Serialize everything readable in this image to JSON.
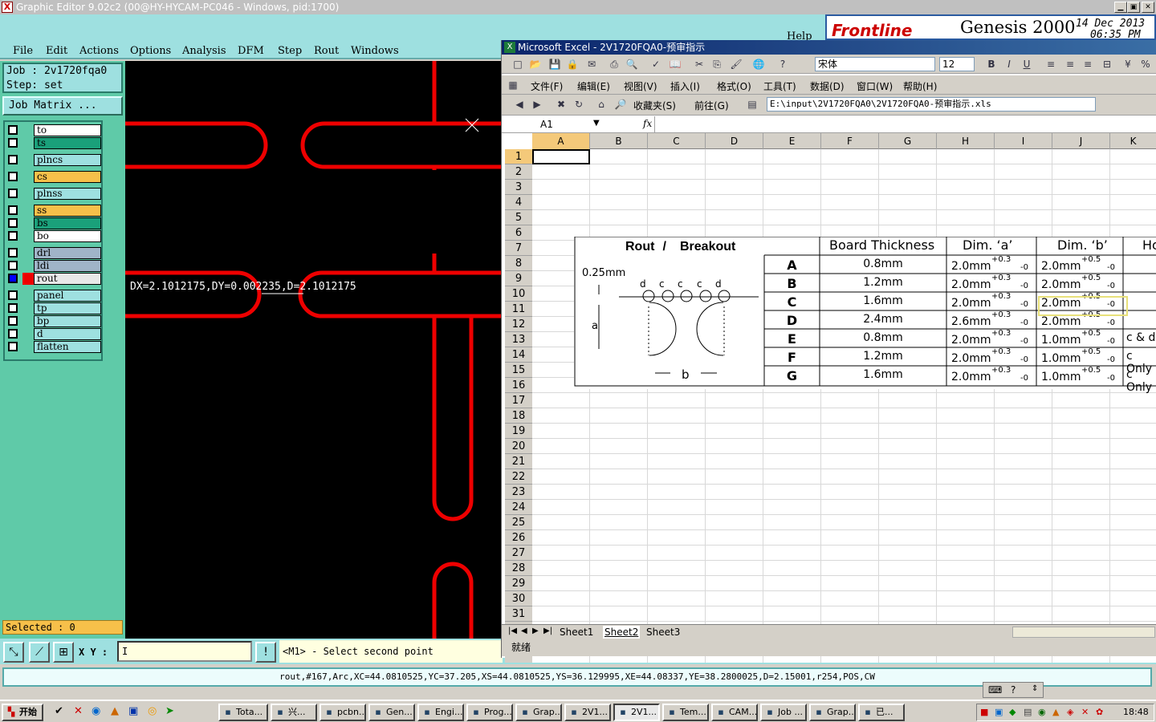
{
  "window": {
    "title": "Graphic Editor 9.02c2 (00@HY-HYCAM-PC046 - Windows, pid:1700)"
  },
  "menu": [
    "File",
    "Edit",
    "Actions",
    "Options",
    "Analysis",
    "DFM",
    "Step",
    "Rout",
    "Windows"
  ],
  "menu_help": "Help",
  "logo": {
    "brand": "Frontline",
    "product": "Genesis 2000",
    "date": "14 Dec 2013",
    "time": "06:35 PM"
  },
  "job": {
    "job_line": "Job  : 2v1720fqa0",
    "step_line": "Step: set",
    "matrix_button": "Job Matrix ..."
  },
  "layers": [
    {
      "name": "to",
      "color": "#ffffff"
    },
    {
      "name": "ts",
      "color": "#1aa07a"
    },
    {
      "name": "plncs",
      "color": "#9ee0e0"
    },
    {
      "name": "cs",
      "color": "#f6c04a"
    },
    {
      "name": "plnss",
      "color": "#9ee0e0"
    },
    {
      "name": "ss",
      "color": "#f6c04a"
    },
    {
      "name": "bs",
      "color": "#1aa07a"
    },
    {
      "name": "bo",
      "color": "#ffffff"
    },
    {
      "name": "drl",
      "color": "#a0b4c8"
    },
    {
      "name": "ldi",
      "color": "#a0b4c8"
    },
    {
      "name": "rout",
      "color": "#e8e8e8"
    },
    {
      "name": "panel",
      "color": "#9ee0e0"
    },
    {
      "name": "tp",
      "color": "#9ee0e0"
    },
    {
      "name": "bp",
      "color": "#9ee0e0"
    },
    {
      "name": "d",
      "color": "#9ee0e0"
    },
    {
      "name": "flatten",
      "color": "#9ee0e0"
    }
  ],
  "canvas": {
    "measure": "DX=2.1012175,DY=0.002235,D=2.1012175"
  },
  "selected": "Selected : 0",
  "xy_label": "X Y :",
  "xy_value": "I",
  "hint_button": "!",
  "hint": "<M1> - Select second point",
  "status_line": "rout,#167,Arc,XC=44.0810525,YC=37.205,XS=44.0810525,YS=36.129995,XE=44.08337,YE=38.2800025,D=2.15001,r254,POS,CW",
  "excel": {
    "title": "Microsoft Excel - 2V1720FQA0-预审指示",
    "font": "宋体",
    "font_size": "12",
    "menu": [
      "文件(F)",
      "编辑(E)",
      "视图(V)",
      "插入(I)",
      "格式(O)",
      "工具(T)",
      "数据(D)",
      "窗口(W)",
      "帮助(H)"
    ],
    "fav_label": "收藏夹(S)",
    "go_label": "前往(G)",
    "address": "E:\\input\\2V1720FQA0\\2V1720FQA0-预审指示.xls",
    "name_box": "A1",
    "fx": "fx",
    "columns": [
      "A",
      "B",
      "C",
      "D",
      "E",
      "F",
      "G",
      "H",
      "I",
      "J",
      "K"
    ],
    "rows": [
      "1",
      "2",
      "3",
      "4",
      "5",
      "6",
      "7",
      "8",
      "9",
      "10",
      "11",
      "12",
      "13",
      "14",
      "15",
      "16",
      "17",
      "18",
      "19",
      "20",
      "21",
      "22",
      "23",
      "24",
      "25",
      "26",
      "27",
      "28",
      "29",
      "30",
      "31"
    ],
    "sheets": [
      "Sheet1",
      "Sheet2",
      "Sheet3"
    ],
    "status": "就绪",
    "table": {
      "title_rout": "Rout",
      "title_sep": " / ",
      "title_breakout": "Breakout",
      "diagram_dim": "0.25mm",
      "diagram_letters": {
        "d": "d",
        "c": "c",
        "a": "a",
        "b": "b"
      },
      "headers": [
        "Board Thickness",
        "Dim. ‘a’",
        "Dim. ‘b’",
        "Ho"
      ],
      "tol_a_up": "+0.3",
      "tol_b_up": "+0.5",
      "tol_down": "-0",
      "rows": [
        {
          "k": "A",
          "t": "0.8mm",
          "a": "2.0mm",
          "b": "2.0mm",
          "h": ""
        },
        {
          "k": "B",
          "t": "1.2mm",
          "a": "2.0mm",
          "b": "2.0mm",
          "h": ""
        },
        {
          "k": "C",
          "t": "1.6mm",
          "a": "2.0mm",
          "b": "2.0mm",
          "h": ""
        },
        {
          "k": "D",
          "t": "2.4mm",
          "a": "2.6mm",
          "b": "2.0mm",
          "h": ""
        },
        {
          "k": "E",
          "t": "0.8mm",
          "a": "2.0mm",
          "b": "1.0mm",
          "h": "c & d"
        },
        {
          "k": "F",
          "t": "1.2mm",
          "a": "2.0mm",
          "b": "1.0mm",
          "h": "c Only"
        },
        {
          "k": "G",
          "t": "1.6mm",
          "a": "2.0mm",
          "b": "1.0mm",
          "h": "c Only"
        }
      ]
    }
  },
  "taskbar": {
    "start": "开始",
    "tasks": [
      "Tota...",
      "兴...",
      "pcbn...",
      "Gen...",
      "Engi...",
      "Prog...",
      "Grap...",
      "2V1...",
      "2V1...",
      "Tem...",
      "CAM...",
      "Job ...",
      "Grap...",
      "已..."
    ],
    "clock": "18:48"
  }
}
